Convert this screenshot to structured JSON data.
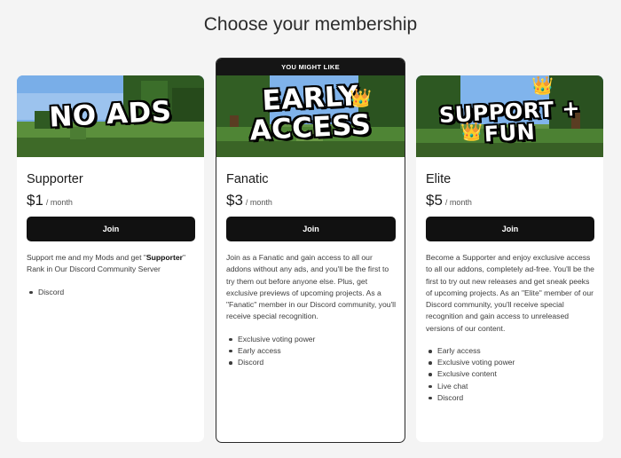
{
  "page": {
    "title": "Choose your membership"
  },
  "tiers": [
    {
      "banner": "NO ADS",
      "name": "Supporter",
      "price": "$1",
      "period": "/ month",
      "join_label": "Join",
      "desc_pre": "Support me and my Mods and get \"",
      "desc_bold": "Supporter",
      "desc_post": "\" Rank in Our Discord Community Server",
      "perks": [
        "Discord"
      ]
    },
    {
      "ribbon": "YOU MIGHT LIKE",
      "banner_line1": "EARLY",
      "banner_line2": "ACCESS",
      "name": "Fanatic",
      "price": "$3",
      "period": "/ month",
      "join_label": "Join",
      "desc": "Join as a Fanatic and gain access to all our addons without any ads, and you'll be the first to try them out before anyone else. Plus, get exclusive previews of upcoming projects. As a \"Fanatic\" member in our Discord community, you'll receive special recognition.",
      "perks": [
        "Exclusive voting power",
        "Early access",
        "Discord"
      ]
    },
    {
      "banner_line1": "SUPPORT +",
      "banner_line2": "FUN",
      "name": "Elite",
      "price": "$5",
      "period": "/ month",
      "join_label": "Join",
      "desc": "Become a Supporter and enjoy exclusive access to all our addons, completely ad-free. You'll be the first to try out new releases and get sneak peeks of upcoming projects. As an \"Elite\" member of our Discord community, you'll receive special recognition and gain access to unreleased versions of our content.",
      "perks": [
        "Early access",
        "Exclusive voting power",
        "Exclusive content",
        "Live chat",
        "Discord"
      ]
    }
  ],
  "icons": {
    "crown": "crown-icon"
  },
  "colors": {
    "button": "#111111",
    "background": "#f4f4f4",
    "card": "#ffffff"
  }
}
